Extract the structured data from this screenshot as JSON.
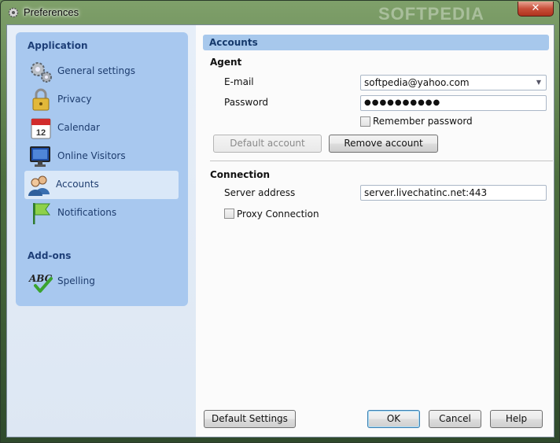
{
  "window": {
    "title": "Preferences",
    "watermark": "SOFTPEDIA",
    "close_glyph": "✕"
  },
  "sidebar": {
    "application_heading": "Application",
    "addons_heading": "Add-ons",
    "items": [
      {
        "label": "General settings",
        "icon": "gears-icon"
      },
      {
        "label": "Privacy",
        "icon": "padlock-icon"
      },
      {
        "label": "Calendar",
        "icon": "calendar-icon"
      },
      {
        "label": "Online Visitors",
        "icon": "monitor-icon"
      },
      {
        "label": "Accounts",
        "icon": "users-icon",
        "selected": true
      },
      {
        "label": "Notifications",
        "icon": "flag-icon"
      }
    ],
    "addons": [
      {
        "label": "Spelling",
        "icon": "spellcheck-icon"
      }
    ],
    "calendar_day": "12",
    "spelling_glyph": "ABC"
  },
  "accounts": {
    "header": "Accounts",
    "agent_heading": "Agent",
    "email_label": "E-mail",
    "email_value": "softpedia@yahoo.com",
    "password_label": "Password",
    "password_value": "●●●●●●●●●●",
    "remember_label": "Remember password",
    "remember_checked": false,
    "default_account_button": "Default account",
    "remove_account_button": "Remove account",
    "connection_heading": "Connection",
    "server_label": "Server address",
    "server_value": "server.livechatinc.net:443",
    "proxy_label": "Proxy Connection",
    "proxy_checked": false
  },
  "footer": {
    "default_settings_button": "Default Settings",
    "ok_button": "OK",
    "cancel_button": "Cancel",
    "help_button": "Help"
  },
  "colors": {
    "sidebar_bg": "#a8c8ef",
    "header_bar": "#a7c8ec",
    "heading_text": "#1e3f78",
    "close_button": "#c8503a"
  }
}
